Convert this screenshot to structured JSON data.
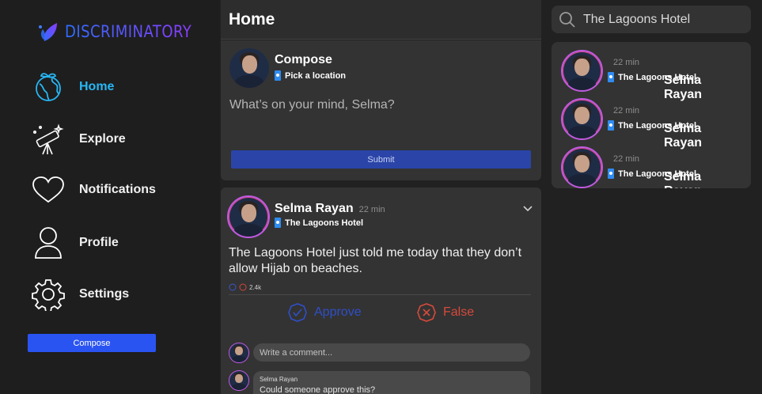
{
  "app": {
    "logo_text": "DISCRIMINATORY",
    "accent_color": "#27b7f5",
    "brand_gradient": [
      "#2f6dff",
      "#8b3cff"
    ]
  },
  "sidebar": {
    "items": [
      {
        "label": "Home",
        "icon": "globe-icon",
        "active": true
      },
      {
        "label": "Explore",
        "icon": "telescope-icon",
        "active": false
      },
      {
        "label": "Notifications",
        "icon": "heart-icon",
        "active": false
      },
      {
        "label": "Profile",
        "icon": "user-icon",
        "active": false
      },
      {
        "label": "Settings",
        "icon": "gear-icon",
        "active": false
      }
    ],
    "compose_label": "Compose"
  },
  "header": {
    "title": "Home"
  },
  "compose": {
    "title": "Compose",
    "location_placeholder": "Pick a location",
    "prompt": "What’s on your mind, Selma?",
    "submit_label": "Submit"
  },
  "post": {
    "author": "Selma Rayan",
    "time": "22 min",
    "location": "The Lagoons Hotel",
    "text": "The Lagoons Hotel just told me today that they don’t allow Hijab on beaches.",
    "reaction_count": "2.4k",
    "approve_label": "Approve",
    "false_label": "False",
    "comment_placeholder": "Write a comment...",
    "comments": [
      {
        "author": "Selma Rayan",
        "text": "Could someone approve this?"
      }
    ]
  },
  "search": {
    "value": "The Lagoons Hotel"
  },
  "results": [
    {
      "name": "Selma Rayan",
      "time": "22 min",
      "location": "The Lagoons Hotel"
    },
    {
      "name": "Selma Rayan",
      "time": "22 min",
      "location": "The Lagoons Hotel"
    },
    {
      "name": "Selma Rayan",
      "time": "22 min",
      "location": "The Lagoons Hotel"
    }
  ]
}
